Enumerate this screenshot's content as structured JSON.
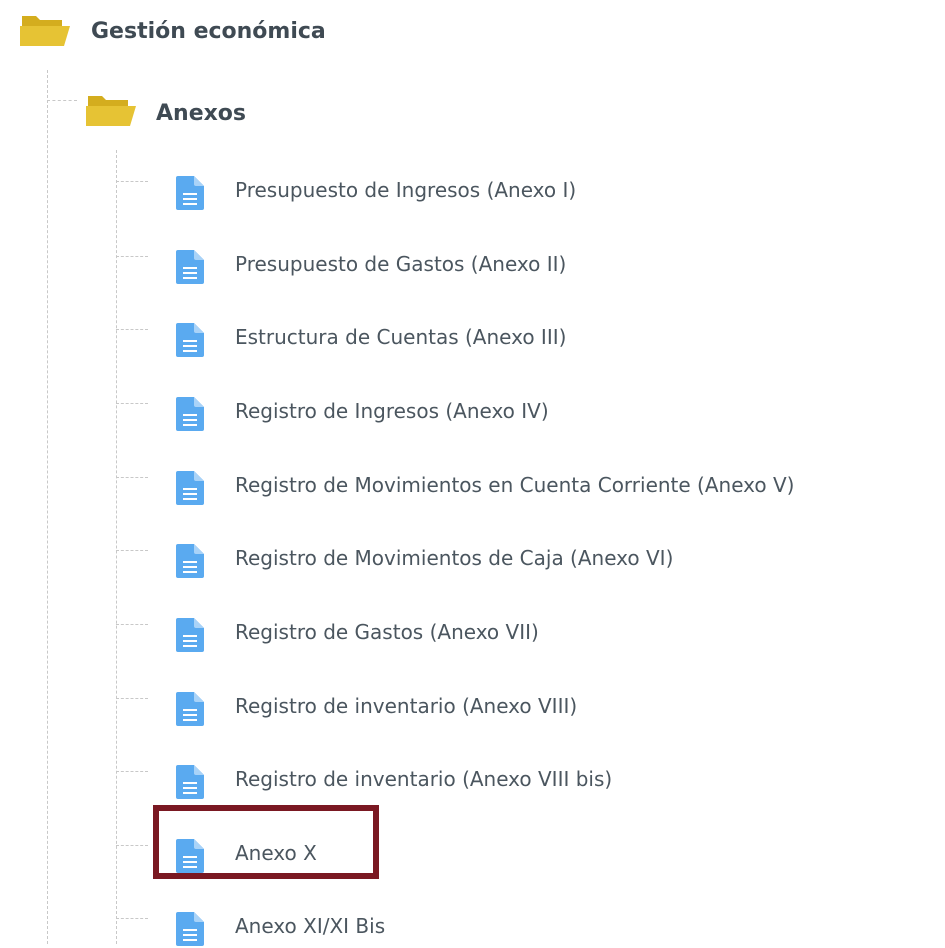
{
  "tree": {
    "root": {
      "label": "Gestión económica",
      "icon": "folder-open-icon"
    },
    "folder": {
      "label": "Anexos",
      "icon": "folder-open-icon"
    },
    "items": [
      {
        "label": "Presupuesto de Ingresos (Anexo I)",
        "icon": "document-icon"
      },
      {
        "label": "Presupuesto de Gastos (Anexo II)",
        "icon": "document-icon"
      },
      {
        "label": "Estructura de Cuentas (Anexo III)",
        "icon": "document-icon"
      },
      {
        "label": "Registro de Ingresos (Anexo IV)",
        "icon": "document-icon"
      },
      {
        "label": "Registro de Movimientos en Cuenta Corriente (Anexo V)",
        "icon": "document-icon"
      },
      {
        "label": "Registro de Movimientos de Caja (Anexo VI)",
        "icon": "document-icon"
      },
      {
        "label": "Registro de Gastos (Anexo VII)",
        "icon": "document-icon"
      },
      {
        "label": "Registro de inventario (Anexo VIII)",
        "icon": "document-icon"
      },
      {
        "label": "Registro de inventario (Anexo VIII bis)",
        "icon": "document-icon"
      },
      {
        "label": "Anexo X",
        "icon": "document-icon",
        "highlighted": true
      },
      {
        "label": "Anexo XI/XI Bis",
        "icon": "document-icon"
      }
    ]
  },
  "colors": {
    "folder": "#e6c334",
    "document": "#5aaaf0",
    "text": "#4b565f",
    "highlight_border": "#7a1822",
    "dashed_line": "#c8c8c8"
  }
}
